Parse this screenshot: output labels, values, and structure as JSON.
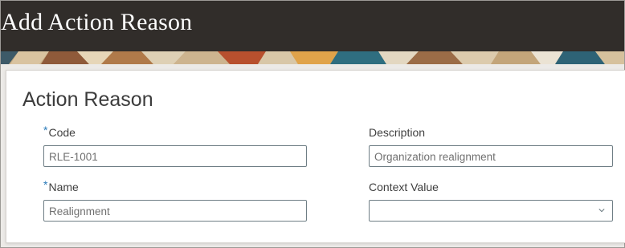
{
  "page": {
    "title": "Add Action Reason"
  },
  "section": {
    "title": "Action Reason"
  },
  "form": {
    "code": {
      "label": "Code",
      "value": "RLE-1001",
      "required": true
    },
    "name": {
      "label": "Name",
      "value": "Realignment",
      "required": true
    },
    "description": {
      "label": "Description",
      "value": "Organization realignment"
    },
    "context_value": {
      "label": "Context Value",
      "value": "",
      "icon": "chevron-down-icon"
    },
    "required_marker": "*"
  },
  "colors": {
    "header_bg": "#312d2a",
    "required_marker": "#2a7ab9",
    "field_border": "#6f7e85"
  }
}
